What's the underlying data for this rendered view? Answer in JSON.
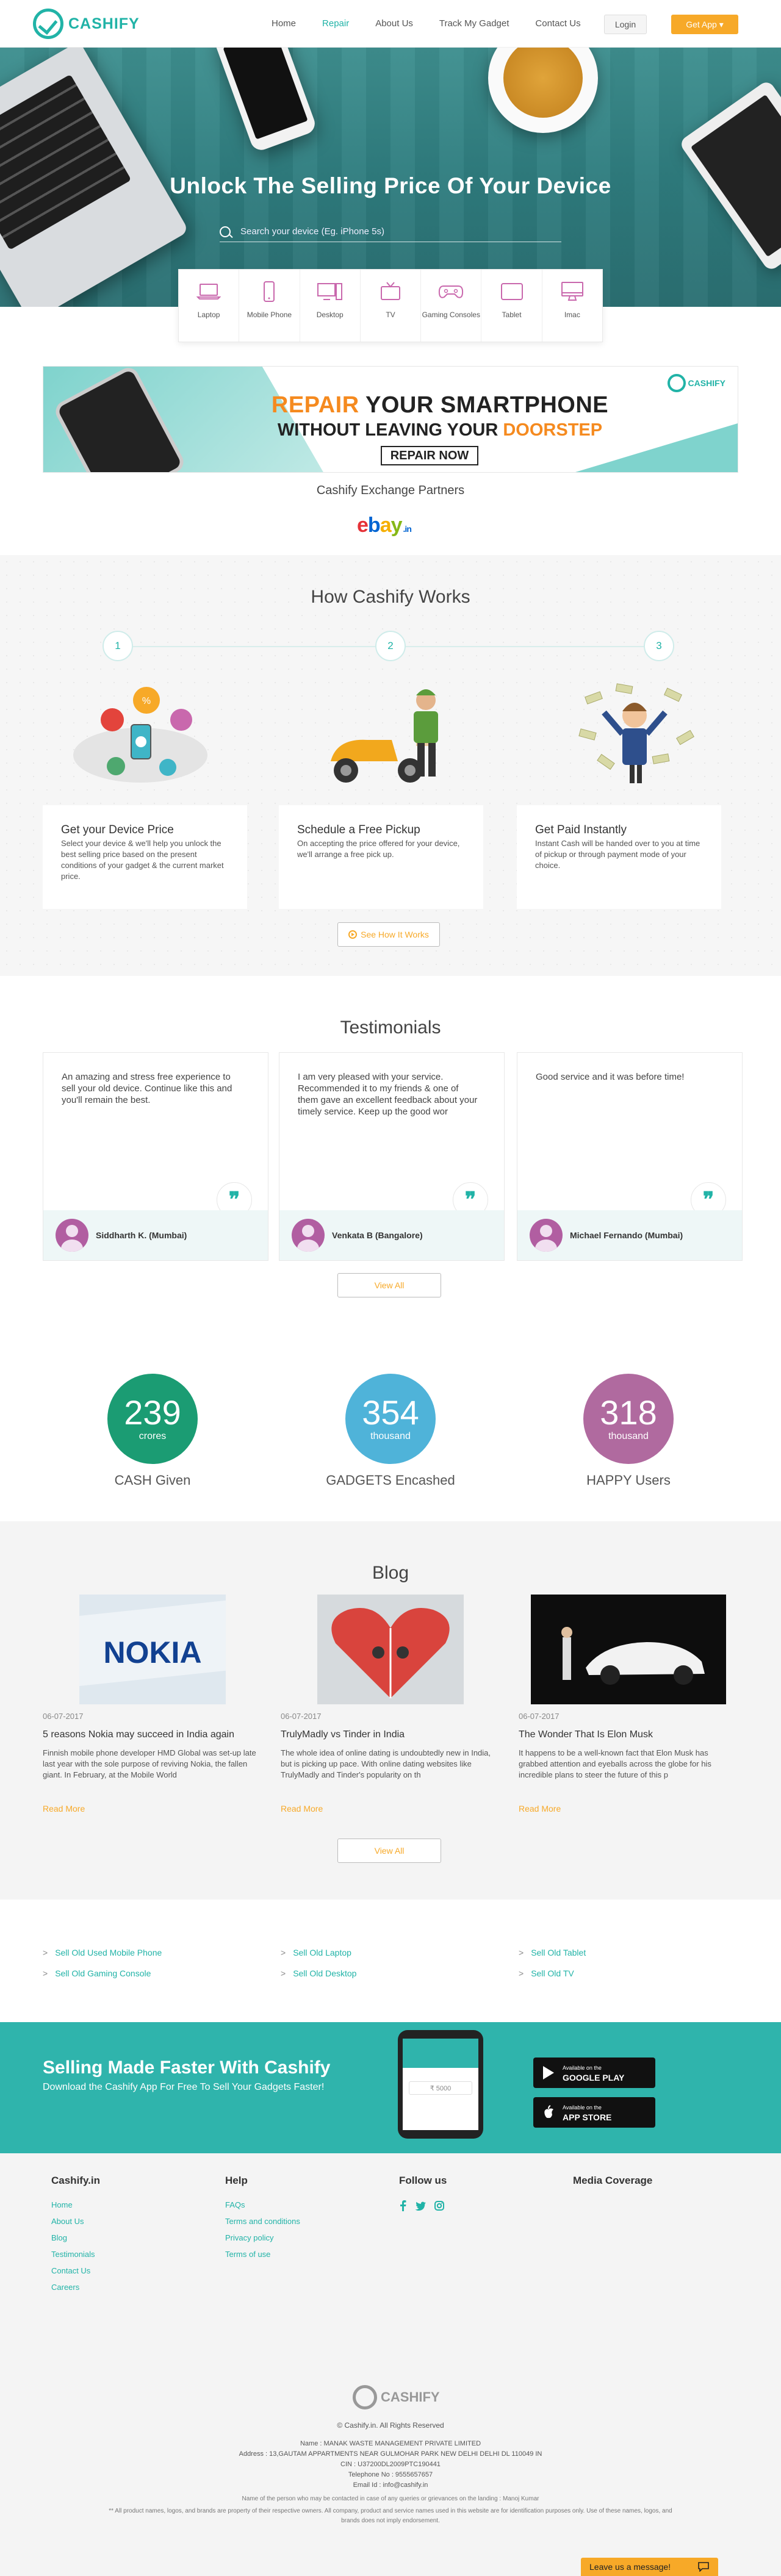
{
  "header": {
    "logo_text": "CASHIFY",
    "nav": [
      "Home",
      "Repair",
      "About Us",
      "Track My Gadget",
      "Contact Us"
    ],
    "login_label": "Login",
    "get_app_label": "Get App"
  },
  "hero": {
    "title": "Unlock The Selling Price Of Your Device",
    "search_placeholder": "Search your device (Eg. iPhone 5s)"
  },
  "categories": [
    "Laptop",
    "Mobile Phone",
    "Desktop",
    "TV",
    "Gaming Consoles",
    "Tablet",
    "Imac"
  ],
  "promo": {
    "line1_highlight": "REPAIR",
    "line1_rest": " YOUR SMARTPHONE",
    "line2_prefix": "WITHOUT LEAVING YOUR ",
    "line2_highlight": "DOORSTEP",
    "button": "REPAIR NOW",
    "logo": "CASHIFY"
  },
  "partners": {
    "title": "Cashify Exchange Partners",
    "ebay_suffix": ".in"
  },
  "how": {
    "title": "How Cashify Works",
    "steps": [
      {
        "num": "1",
        "title": "Get your Device Price",
        "text": "Select your device & we'll help you unlock the best selling price based on the present conditions of your gadget & the current market price."
      },
      {
        "num": "2",
        "title": "Schedule a Free Pickup",
        "text": "On accepting the price offered for your device, we'll arrange a free pick up."
      },
      {
        "num": "3",
        "title": "Get Paid Instantly",
        "text": "Instant Cash will be handed over to you at time of pickup or through payment mode of your choice."
      }
    ],
    "see_label": "See How It Works"
  },
  "testimonials": {
    "title": "Testimonials",
    "items": [
      {
        "quote": "An amazing and stress free experience to sell your old device. Continue like this and you'll remain the best.",
        "name": "Siddharth K. (Mumbai)"
      },
      {
        "quote": "I am very pleased with your service. Recommended it to my friends & one of them gave an excellent feedback about your timely service. Keep up the good wor",
        "name": "Venkata B (Bangalore)"
      },
      {
        "quote": "Good service and it was before time!",
        "name": "Michael Fernando (Mumbai)"
      }
    ],
    "view_all": "View All"
  },
  "stats": [
    {
      "value": "239",
      "unit": "crores",
      "label": "CASH Given",
      "color": "#1b9c73"
    },
    {
      "value": "354",
      "unit": "thousand",
      "label": "GADGETS Encashed",
      "color": "#4fb3d9"
    },
    {
      "value": "318",
      "unit": "thousand",
      "label": "HAPPY Users",
      "color": "#b06a9f"
    }
  ],
  "blog": {
    "title": "Blog",
    "posts": [
      {
        "date": "06-07-2017",
        "title": "5 reasons Nokia may succeed in India again",
        "excerpt": "Finnish mobile phone developer HMD Global was set-up late last year with the sole purpose of reviving Nokia, the fallen giant. In February, at the Mobile World",
        "more": "Read More",
        "img_text": "NOKIA"
      },
      {
        "date": "06-07-2017",
        "title": "TrulyMadly vs Tinder in India",
        "excerpt": "The whole idea of online dating is undoubtedly new in India, but is picking up pace. With online dating websites like TrulyMadly and Tinder's popularity on th",
        "more": "Read More"
      },
      {
        "date": "06-07-2017",
        "title": "The Wonder That Is Elon Musk",
        "excerpt": "It happens to be a well-known fact that Elon Musk has grabbed attention and eyeballs across the globe for his incredible plans to steer the future of this p",
        "more": "Read More"
      }
    ],
    "view_all": "View All"
  },
  "sell_links": [
    "Sell Old Used Mobile Phone",
    "Sell Old Laptop",
    "Sell Old Tablet",
    "Sell Old Gaming Console",
    "Sell Old Desktop",
    "Sell Old TV"
  ],
  "app_banner": {
    "title": "Selling Made Faster With Cashify",
    "subtitle": "Download the Cashify App For Free To Sell Your Gadgets Faster!",
    "phone_price": "₹ 5000",
    "google_small": "Available on the",
    "google_big": "GOOGLE PLAY",
    "apple_small": "Available on the",
    "apple_big": "APP STORE"
  },
  "footer": {
    "col1_title": "Cashify.in",
    "col1_links": [
      "Home",
      "About Us",
      "Blog",
      "Testimonials",
      "Contact Us",
      "Careers"
    ],
    "col2_title": "Help",
    "col2_links": [
      "FAQs",
      "Terms and conditions",
      "Privacy policy",
      "Terms of use"
    ],
    "col3_title": "Follow us",
    "col4_title": "Media Coverage",
    "logo": "CASHIFY",
    "copyright": "© Cashify.in. All Rights Reserved",
    "lines": [
      "Name : MANAK WASTE MANAGEMENT PRIVATE LIMITED",
      "Address : 13,GAUTAM APPARTMENTS NEAR GULMOHAR PARK NEW DELHI DELHI DL 110049 IN",
      "CIN : U37200DL2009PTC190441",
      "Telephone No : 9555657657",
      "Email Id : info@cashify.in",
      "Name of the person who may be contacted in case of any queries or grievances on the landing : Manoj Kumar",
      "** All product names, logos, and brands are property of their respective owners. All company, product and service names used in this website are for identification purposes only. Use of these names, logos, and",
      "brands does not imply endorsement."
    ]
  },
  "chat": {
    "label": "Leave us a message!"
  }
}
